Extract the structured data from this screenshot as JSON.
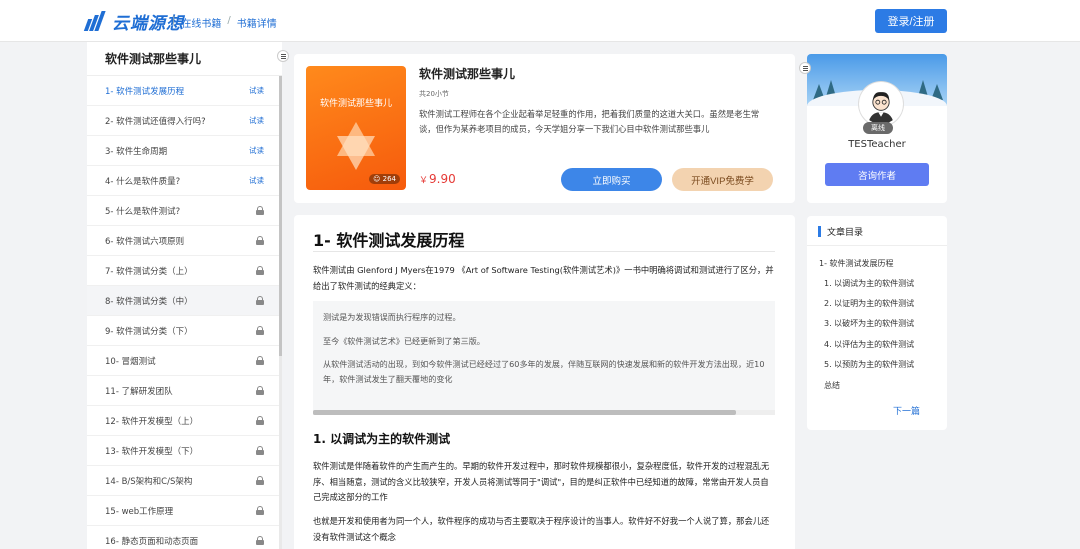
{
  "header": {
    "logo_text": "云端源想",
    "breadcrumb": [
      "在线书籍",
      "书籍详情"
    ],
    "login_label": "登录/注册"
  },
  "sidebar": {
    "title": "软件测试那些事儿",
    "try_label": "试读",
    "items": [
      {
        "label": "1- 软件测试发展历程",
        "state": "try"
      },
      {
        "label": "2- 软件测试还值得入行吗?",
        "state": "try"
      },
      {
        "label": "3- 软件生命周期",
        "state": "try"
      },
      {
        "label": "4- 什么是软件质量?",
        "state": "try"
      },
      {
        "label": "5- 什么是软件测试?",
        "state": "locked"
      },
      {
        "label": "6- 软件测试六项原则",
        "state": "locked"
      },
      {
        "label": "7- 软件测试分类（上）",
        "state": "locked"
      },
      {
        "label": "8- 软件测试分类（中）",
        "state": "locked"
      },
      {
        "label": "9- 软件测试分类（下）",
        "state": "locked"
      },
      {
        "label": "10- 冒烟测试",
        "state": "locked"
      },
      {
        "label": "11- 了解研发团队",
        "state": "locked"
      },
      {
        "label": "12- 软件开发模型（上）",
        "state": "locked"
      },
      {
        "label": "13- 软件开发模型（下）",
        "state": "locked"
      },
      {
        "label": "14- B/S架构和C/S架构",
        "state": "locked"
      },
      {
        "label": "15- web工作原理",
        "state": "locked"
      },
      {
        "label": "16- 静态页面和动态页面",
        "state": "locked"
      }
    ]
  },
  "book": {
    "cover_title": "软件测试那些事儿",
    "cover_count": "264",
    "title": "软件测试那些事儿",
    "sections": "共20小节",
    "description": "软件测试工程师在各个企业起着举足轻重的作用，把着我们质量的这道大关口。虽然是老生常谈，但作为某养老项目的成员，今天学姐分享一下我们心目中软件测试那些事儿",
    "price_symbol": "￥",
    "price": "9.90",
    "buy_label": "立即购买",
    "vip_label": "开通VIP免费学"
  },
  "article": {
    "h1": "1- 软件测试发展历程",
    "intro": "软件测试由 Glenford J Myers在1979 《Art of Software Testing(软件测试艺术)》一书中明确将调试和测试进行了区分，并给出了软件测试的经典定义：",
    "quote_lines": [
      "测试是为发现错误而执行程序的过程。",
      "至今《软件测试艺术》已经更新到了第三版。",
      "从软件测试活动的出现，到如今软件测试已经经过了60多年的发展，伴随互联网的快速发展和新的软件开发方法出现，近10年，软件测试发生了翻天覆地的变化"
    ],
    "h2": "1. 以调试为主的软件测试",
    "para2": "软件测试是伴随着软件的产生而产生的。早期的软件开发过程中，那时软件规模都很小，复杂程度低，软件开发的过程混乱无序、相当随意，测试的含义比较狭窄，开发人员将测试等同于\"调试\"，目的是纠正软件中已经知道的故障，常常由开发人员自己完成这部分的工作",
    "para3": "也就是开发和使用者为同一个人，软件程序的成功与否主要取决于程序设计的当事人。软件好不好我一个人说了算，那会儿还没有软件测试这个概念"
  },
  "author": {
    "status": "离线",
    "name": "TESTeacher",
    "consult_label": "咨询作者"
  },
  "toc": {
    "title": "文章目录",
    "items": [
      "1- 软件测试发展历程",
      "1. 以调试为主的软件测试",
      "2. 以证明为主的软件测试",
      "3. 以破坏为主的软件测试",
      "4. 以评估为主的软件测试",
      "5. 以预防为主的软件测试",
      "总结"
    ],
    "next_label": "下一篇"
  },
  "colors": {
    "brand": "#1f6ed4",
    "primary_button": "#2c7be5",
    "price": "#e53935",
    "cover": "#f65a0c",
    "vip": "#f3d3b0",
    "consult": "#5f7cf2"
  }
}
